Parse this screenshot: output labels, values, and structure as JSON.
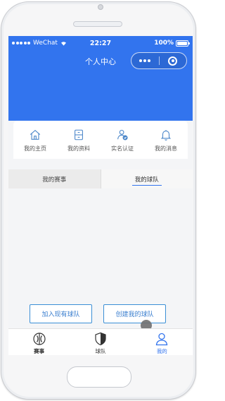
{
  "status_bar": {
    "carrier": "WeChat",
    "time": "22:27",
    "battery": "100%"
  },
  "nav": {
    "title": "个人中心"
  },
  "menu": {
    "items": [
      {
        "label": "我的主页",
        "icon": "home-icon"
      },
      {
        "label": "我的资料",
        "icon": "profile-icon"
      },
      {
        "label": "实名认证",
        "icon": "verify-icon"
      },
      {
        "label": "我的消息",
        "icon": "bell-icon"
      }
    ]
  },
  "tabs": {
    "items": [
      {
        "label": "我的赛事",
        "active": false
      },
      {
        "label": "我的球队",
        "active": true
      }
    ]
  },
  "actions": {
    "join_label": "加入现有球队",
    "create_label": "创建我的球队"
  },
  "tabbar": {
    "items": [
      {
        "label": "赛事",
        "icon": "ball-icon",
        "active": false
      },
      {
        "label": "球队",
        "icon": "shield-icon",
        "active": false
      },
      {
        "label": "我的",
        "icon": "user-icon",
        "active": true
      }
    ]
  },
  "colors": {
    "brand": "#3274ee",
    "button_border": "#3b8fd6"
  }
}
